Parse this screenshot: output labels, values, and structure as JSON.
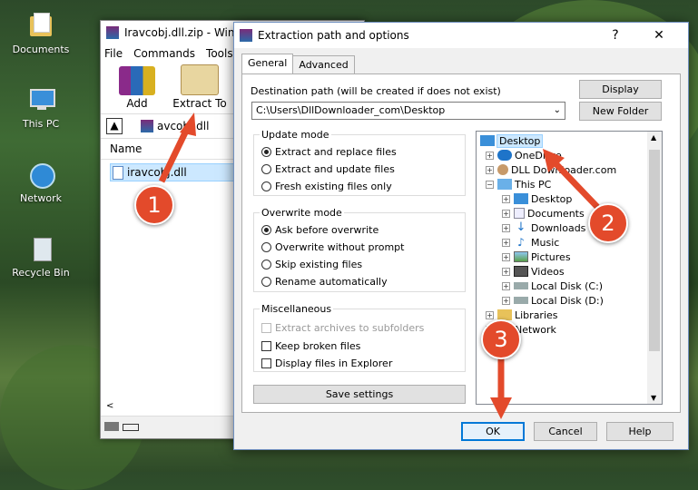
{
  "desktop": {
    "icons": [
      {
        "label": "Documents"
      },
      {
        "label": "This PC"
      },
      {
        "label": "Network"
      },
      {
        "label": "Recycle Bin"
      }
    ]
  },
  "winrar": {
    "title": "Iravcobj.dll.zip - Win",
    "menu": [
      "File",
      "Commands",
      "Tools"
    ],
    "toolbar": {
      "add": "Add",
      "extract_to": "Extract To"
    },
    "path": "avcobj.dll",
    "column_name": "Name",
    "file": "iravcobj.dll"
  },
  "dialog": {
    "title": "Extraction path and options",
    "help": "?",
    "close": "✕",
    "tabs": [
      "General",
      "Advanced"
    ],
    "dest_label": "Destination path (will be created if does not exist)",
    "dest_value": "C:\\Users\\DllDownloader_com\\Desktop",
    "display_btn": "Display",
    "new_folder_btn": "New Folder",
    "update_mode": {
      "title": "Update mode",
      "options": [
        "Extract and replace files",
        "Extract and update files",
        "Fresh existing files only"
      ],
      "selected": 0
    },
    "overwrite_mode": {
      "title": "Overwrite mode",
      "options": [
        "Ask before overwrite",
        "Overwrite without prompt",
        "Skip existing files",
        "Rename automatically"
      ],
      "selected": 0
    },
    "misc": {
      "title": "Miscellaneous",
      "options": [
        "Extract archives to subfolders",
        "Keep broken files",
        "Display files in Explorer"
      ]
    },
    "save_settings": "Save settings",
    "tree": [
      "Desktop",
      "OneDrive",
      "DLL Downloader.com",
      "This PC",
      "Desktop",
      "Documents",
      "Downloads",
      "Music",
      "Pictures",
      "Videos",
      "Local Disk (C:)",
      "Local Disk (D:)",
      "Libraries",
      "Network"
    ],
    "ok": "OK",
    "cancel": "Cancel",
    "help_btn": "Help"
  },
  "annotations": [
    "1",
    "2",
    "3"
  ],
  "colors": {
    "annotation": "#e34a2b",
    "selection": "#cce8ff",
    "accent": "#0078d7"
  }
}
